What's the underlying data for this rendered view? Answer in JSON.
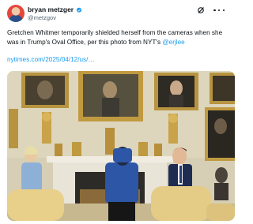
{
  "author": {
    "display_name": "bryan metzger",
    "handle": "@metzgov",
    "verified": true,
    "avatar_icon": "avatar-photo"
  },
  "tweet": {
    "text_before": "Gretchen Whitmer temporarily shielded herself from the cameras when she was in Trump's Oval Office, per this photo from NYT's ",
    "mention": "@erjlee",
    "link": "nytimes.com/2025/04/12/us/…"
  },
  "icons": {
    "grok": "grok-icon",
    "more": "more-options-icon",
    "verified": "verified-badge-icon"
  },
  "colors": {
    "link": "#1d9bf0",
    "secondary_text": "#536471"
  }
}
